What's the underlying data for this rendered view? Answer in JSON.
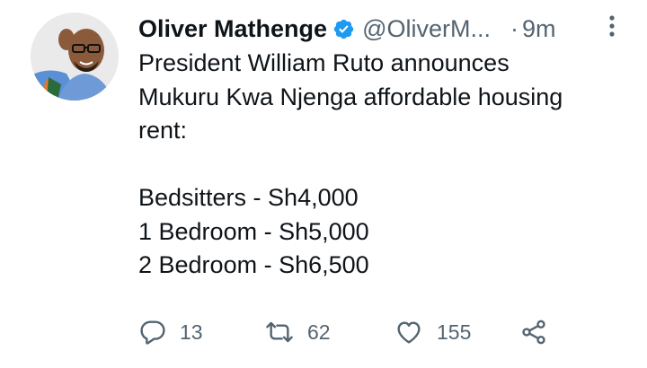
{
  "tweet": {
    "author": {
      "name": "Oliver Mathenge",
      "handle": "@OliverM...",
      "verified_icon": "verified-badge-icon",
      "avatar_icon": "avatar"
    },
    "time_separator": "·",
    "time": "9m",
    "text_lines": [
      "President William Ruto announces",
      "Mukuru Kwa Njenga affordable housing",
      "rent:",
      "",
      "Bedsitters - Sh4,000",
      "1 Bedroom - Sh5,000",
      "2 Bedroom - Sh6,500"
    ],
    "actions": {
      "reply": {
        "icon": "reply-icon",
        "count": "13"
      },
      "retweet": {
        "icon": "retweet-icon",
        "count": "62"
      },
      "like": {
        "icon": "heart-icon",
        "count": "155"
      },
      "share": {
        "icon": "share-icon"
      }
    },
    "more_icon": "more-options-icon"
  },
  "colors": {
    "text": "#0f1419",
    "secondary": "#536471",
    "verified": "#1d9bf0"
  }
}
